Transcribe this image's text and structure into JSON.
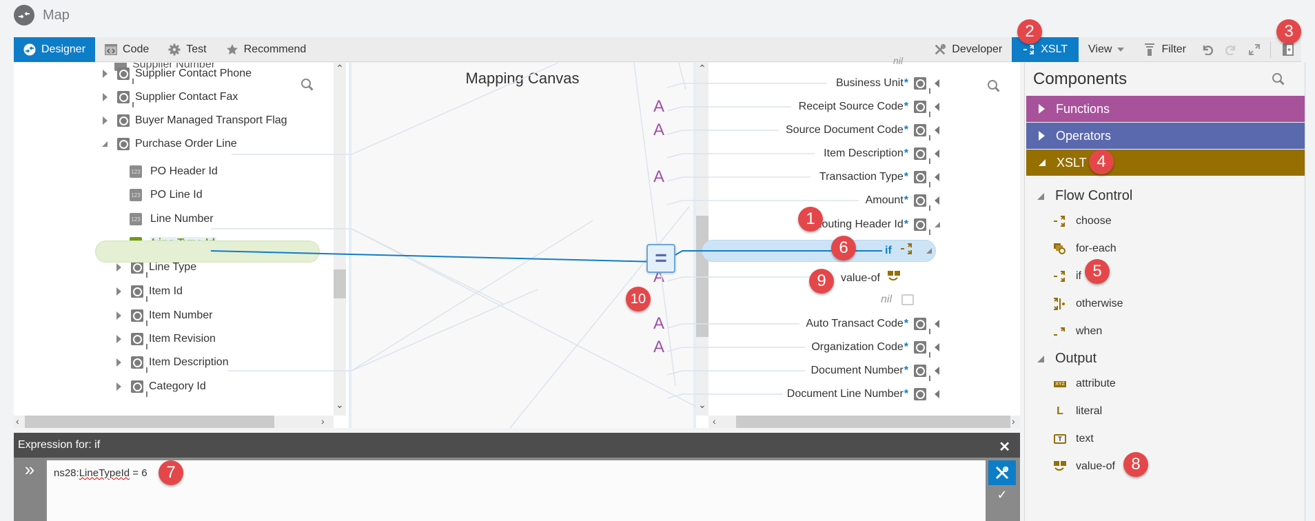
{
  "header": {
    "title": "Map",
    "logo_icon": "map-mapper-icon"
  },
  "toolbar": {
    "left": [
      {
        "label": "Designer",
        "icon": "designer-icon",
        "active": true
      },
      {
        "label": "Code",
        "icon": "code-icon",
        "active": false
      },
      {
        "label": "Test",
        "icon": "gear-icon",
        "active": false
      },
      {
        "label": "Recommend",
        "icon": "star-icon",
        "active": false
      }
    ],
    "right": {
      "developer": "Developer",
      "xslt": "XSLT",
      "view": "View",
      "filter": "Filter"
    },
    "accent_color": "#0e7dc8"
  },
  "source_tree": {
    "partial_top": "Supplier Number",
    "rows": [
      {
        "label": "Supplier Contact Phone",
        "type": "complex",
        "expandable": true
      },
      {
        "label": "Supplier Contact Fax",
        "type": "complex",
        "expandable": true
      },
      {
        "label": "Buyer Managed Transport Flag",
        "type": "complex",
        "expandable": true
      },
      {
        "label": "Purchase Order Line",
        "type": "repeating",
        "expanded": true
      },
      {
        "label": "PO Header Id",
        "type": "number"
      },
      {
        "label": "PO Line Id",
        "type": "number"
      },
      {
        "label": "Line Number",
        "type": "number"
      },
      {
        "label": "Line Type Id",
        "type": "number",
        "selected": true
      },
      {
        "label": "Line Type",
        "type": "complex",
        "expandable": true
      },
      {
        "label": "Item Id",
        "type": "complex",
        "expandable": true
      },
      {
        "label": "Item Number",
        "type": "complex",
        "expandable": true
      },
      {
        "label": "Item Revision",
        "type": "complex",
        "expandable": true
      },
      {
        "label": "Item Description",
        "type": "complex",
        "expandable": true
      },
      {
        "label": "Category Id",
        "type": "complex",
        "expandable": true
      }
    ]
  },
  "canvas": {
    "title": "Mapping Canvas",
    "function_label": "A",
    "operator_symbol": "="
  },
  "target_tree": {
    "partial_top": "nil",
    "rows": [
      {
        "label": "Business Unit",
        "required": true
      },
      {
        "label": "Receipt Source Code",
        "required": true
      },
      {
        "label": "Source Document Code",
        "required": true
      },
      {
        "label": "Item Description",
        "required": true
      },
      {
        "label": "Transaction Type",
        "required": true
      },
      {
        "label": "Amount",
        "required": true
      },
      {
        "label": "Routing Header Id",
        "required": true
      }
    ],
    "if_node": "if",
    "value_of_node": "value-of",
    "nil_node": "nil",
    "rows_after": [
      {
        "label": "Auto Transact Code",
        "required": true
      },
      {
        "label": "Organization Code",
        "required": true
      },
      {
        "label": "Document Number",
        "required": true
      },
      {
        "label": "Document Line Number",
        "required": true
      }
    ],
    "required_marker": "*"
  },
  "components": {
    "title": "Components",
    "categories": [
      {
        "label": "Functions",
        "color": "#a8529c",
        "expanded": false
      },
      {
        "label": "Operators",
        "color": "#5a68ae",
        "expanded": false
      },
      {
        "label": "XSLT",
        "color": "#956f00",
        "expanded": true
      }
    ],
    "flow_control": {
      "label": "Flow Control",
      "items": [
        "choose",
        "for-each",
        "if",
        "otherwise",
        "when"
      ]
    },
    "output": {
      "label": "Output",
      "items": [
        "attribute",
        "literal",
        "text",
        "value-of"
      ],
      "attribute_icon_text": "XYZ",
      "literal_icon_text": "L",
      "text_icon_text": "T"
    }
  },
  "expression": {
    "header": "Expression for: if",
    "prefix": "ns28:",
    "field": "LineTypeId",
    "suffix": " = 6"
  },
  "callouts": [
    "1",
    "2",
    "3",
    "4",
    "5",
    "6",
    "7",
    "8",
    "9",
    "10"
  ]
}
